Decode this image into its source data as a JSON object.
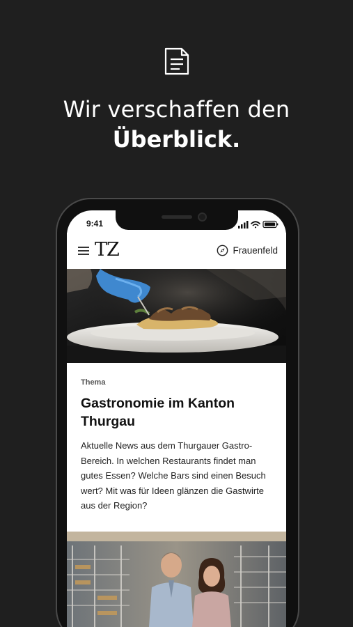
{
  "promo": {
    "icon": "document-icon",
    "headline_line1": "Wir verschaffen den",
    "headline_line2": "Überblick."
  },
  "status_bar": {
    "time": "9:41",
    "icons": [
      "signal-icon",
      "wifi-icon",
      "battery-icon"
    ]
  },
  "app_header": {
    "menu_icon": "hamburger-menu-icon",
    "logo": "TZ",
    "location_icon": "compass-icon",
    "location_label": "Frauenfeld"
  },
  "article": {
    "image": "plated-dish-photo",
    "kicker": "Thema",
    "title": "Gastronomie im Kanton Thurgau",
    "lead": "Aktuelle News aus dem Thurgauer Gastro-Bereich. In welchen Restaurants findet man gutes Essen? Welche Bars sind einen Besuch wert? Mit was für Ideen glänzen die Gastwirte aus der Region?"
  },
  "next_article": {
    "image": "bakery-couple-photo"
  },
  "colors": {
    "background": "#1f1f1f",
    "phone_frame": "#101010",
    "screen": "#ffffff",
    "text_dark": "#111111"
  }
}
